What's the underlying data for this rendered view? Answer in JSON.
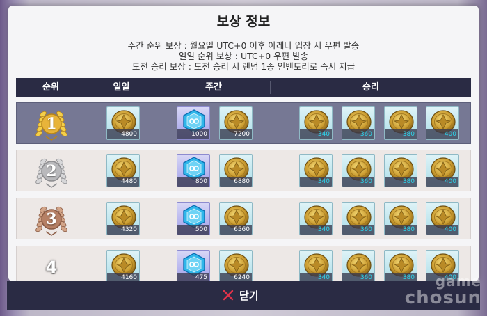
{
  "title": "보상 정보",
  "description": [
    "주간 순위 보상 : 월요일 UTC+0 이후 아레나 입장 시 우편 발송",
    "일일 순위 보상 : UTC+0 우편 발송",
    "도전 승리 보상 : 도전 승리 시 랜덤 1종 인벤토리로 즉시 지급"
  ],
  "columns": {
    "rank": "순위",
    "daily": "일일",
    "weekly": "주간",
    "win": "승리"
  },
  "rows": [
    {
      "rank": "1",
      "medal": "gold",
      "daily": "4800",
      "weekly_gem": "1000",
      "weekly_coin": "7200",
      "win": [
        "340",
        "360",
        "380",
        "400"
      ]
    },
    {
      "rank": "2",
      "medal": "silver",
      "daily": "4480",
      "weekly_gem": "800",
      "weekly_coin": "6880",
      "win": [
        "340",
        "360",
        "380",
        "400"
      ]
    },
    {
      "rank": "3",
      "medal": "bronze",
      "daily": "4320",
      "weekly_gem": "500",
      "weekly_coin": "6560",
      "win": [
        "340",
        "360",
        "380",
        "400"
      ]
    },
    {
      "rank": "4",
      "medal": "none",
      "daily": "4160",
      "weekly_gem": "475",
      "weekly_coin": "6240",
      "win": [
        "340",
        "360",
        "380",
        "400"
      ]
    }
  ],
  "close_label": "닫기",
  "watermark": {
    "line1": "game",
    "line2": "chosun"
  },
  "icons": {
    "coin": "gold-coin-icon",
    "gem": "blue-crystal-icon",
    "close": "close-x-icon"
  },
  "colors": {
    "header_bg": "#2a2b44",
    "highlight_row": "#767894",
    "close_x": "#e0334a",
    "win_qty": "#2ad8ee"
  }
}
